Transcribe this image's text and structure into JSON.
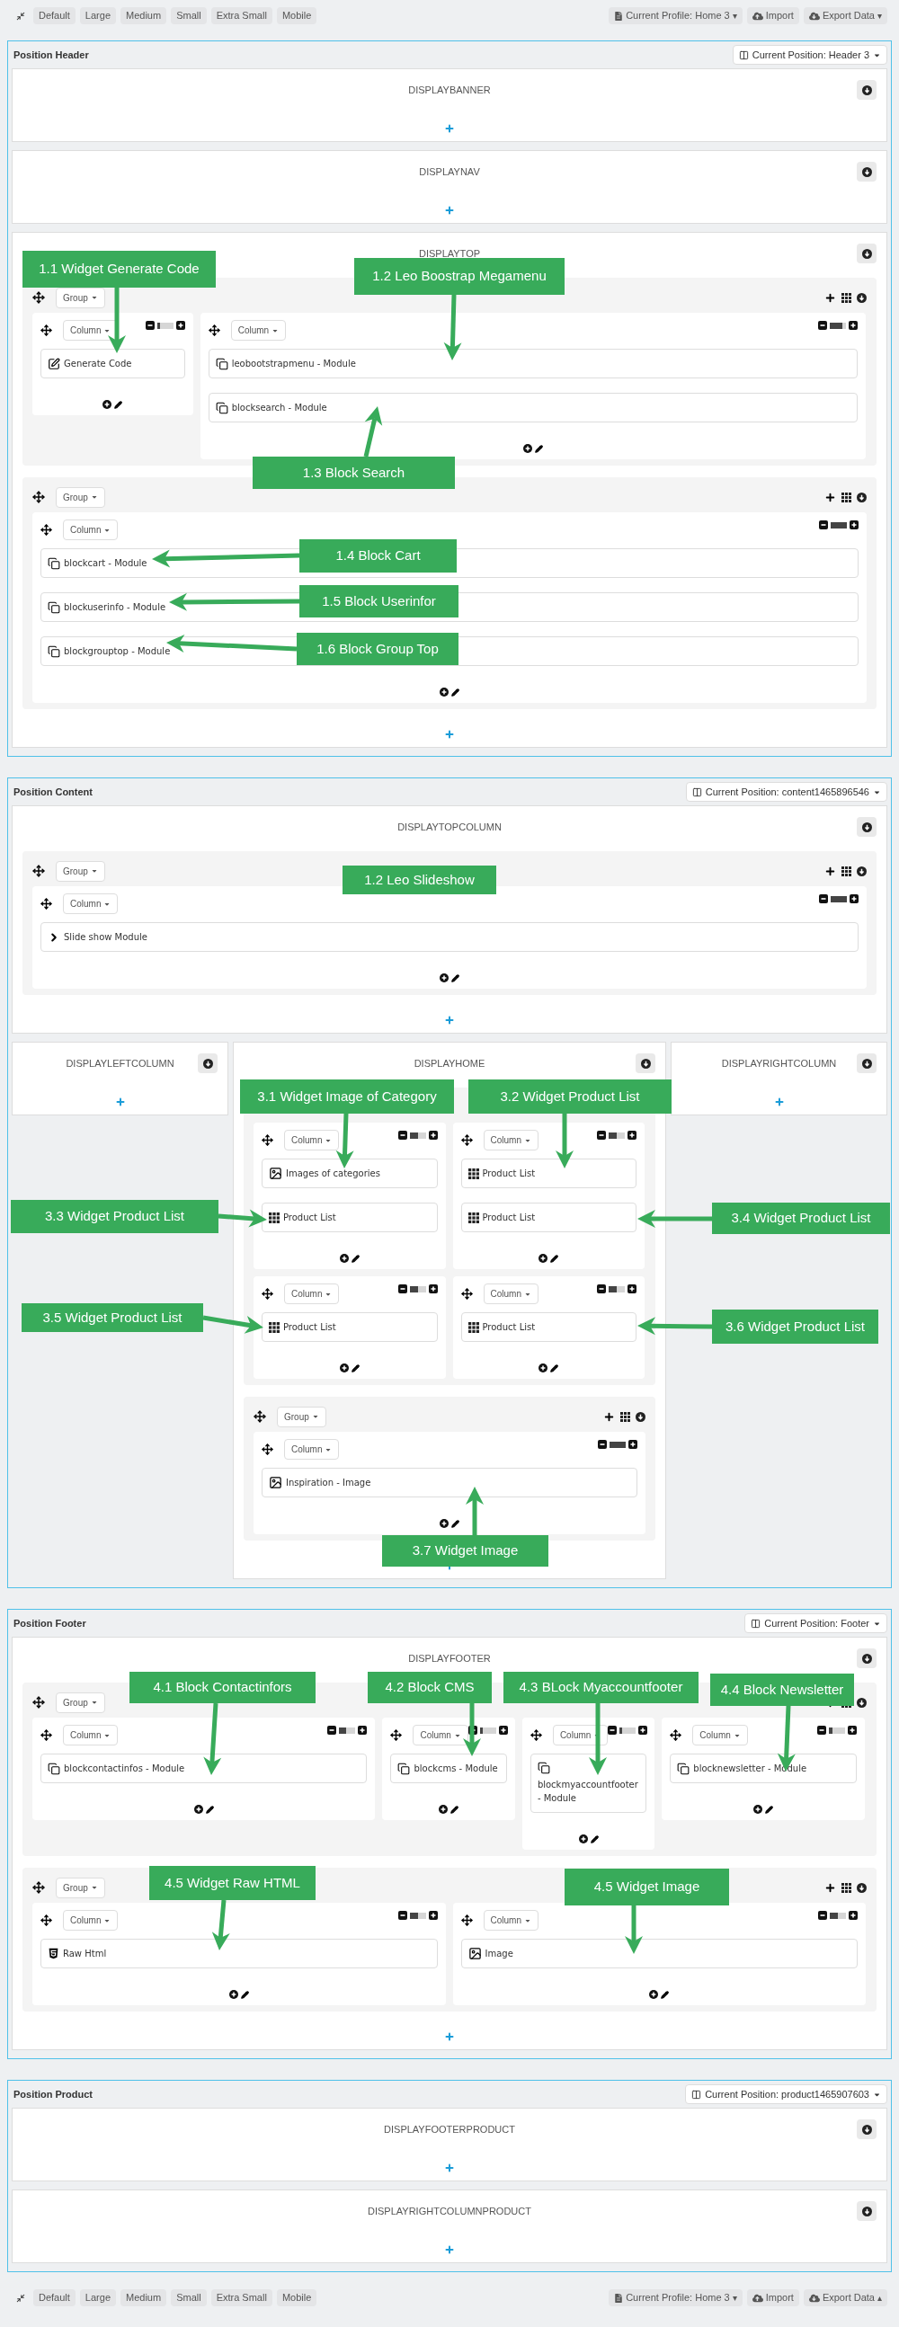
{
  "top_toolbar": {
    "devices": [
      {
        "label": "Default"
      },
      {
        "label": "Large"
      },
      {
        "label": "Medium"
      },
      {
        "label": "Small"
      },
      {
        "label": "Extra Small"
      },
      {
        "label": "Mobile"
      }
    ],
    "actions": [
      {
        "label": "Current Profile: Home 3",
        "caret": "▾"
      },
      {
        "label": "Import"
      },
      {
        "label": "Export Data",
        "caret": "▾"
      }
    ]
  },
  "positions": [
    {
      "title": "Position Header",
      "current_position": "Current Position: Header 3",
      "rows": [
        [
          {
            "name": "DISPLAYBANNER"
          }
        ],
        [
          {
            "name": "DISPLAYNAV"
          }
        ],
        [
          {
            "name": "DISPLAYTOP",
            "groups": [
              {
                "toolbar": true,
                "button": "Group",
                "columns": [
                  {
                    "button": "Column",
                    "level": 0.2,
                    "widgets": [
                      {
                        "kind": "edit",
                        "label": "Generate Code"
                      }
                    ]
                  },
                  {
                    "button": "Column",
                    "level": 0.8,
                    "widgets": [
                      {
                        "kind": "module",
                        "label": "leobootstrapmenu - Module"
                      },
                      {
                        "kind": "module",
                        "label": "blocksearch - Module"
                      }
                    ]
                  }
                ]
              },
              {
                "toolbar": true,
                "button": "Group",
                "columns": [
                  {
                    "button": "Column",
                    "level": 1,
                    "widgets": [
                      {
                        "kind": "module",
                        "label": "blockcart - Module"
                      },
                      {
                        "kind": "module",
                        "label": "blockuserinfo - Module"
                      },
                      {
                        "kind": "module",
                        "label": "blockgrouptop - Module"
                      }
                    ]
                  }
                ]
              }
            ]
          }
        ]
      ],
      "callouts": [
        {
          "label": "1.1 Widget Generate Code"
        },
        {
          "label": "1.2 Leo Boostrap Megamenu"
        },
        {
          "label": "1.3 Block Search"
        },
        {
          "label": "1.4 Block Cart"
        },
        {
          "label": "1.5 Block Userinfor"
        },
        {
          "label": "1.6 Block Group Top"
        }
      ]
    },
    {
      "title": "Position Content",
      "current_position": "Current Position: content1465896546",
      "rows": [
        [
          {
            "name": "DISPLAYTOPCOLUMN",
            "groups": [
              {
                "toolbar": true,
                "button": "Group",
                "columns": [
                  {
                    "button": "Column",
                    "level": 1,
                    "widgets": [
                      {
                        "kind": "chevron",
                        "label": "Slide show Module"
                      }
                    ]
                  }
                ]
              }
            ]
          }
        ],
        [
          {
            "name": "DISPLAYLEFTCOLUMN"
          },
          {
            "name": "DISPLAYHOME",
            "groups": [
              {
                "toolbar": false,
                "columns": [
                  {
                    "button": "Column",
                    "level": 0.5,
                    "widgets": [
                      {
                        "kind": "image",
                        "label": "Images of categories"
                      },
                      {
                        "kind": "grid",
                        "label": "Product List"
                      }
                    ]
                  },
                  {
                    "button": "Column",
                    "level": 0.5,
                    "widgets": [
                      {
                        "kind": "grid",
                        "label": "Product List"
                      },
                      {
                        "kind": "grid",
                        "label": "Product List"
                      }
                    ]
                  },
                  {
                    "button": "Column",
                    "level": 0.5,
                    "widgets": [
                      {
                        "kind": "grid",
                        "label": "Product List"
                      }
                    ]
                  },
                  {
                    "button": "Column",
                    "level": 0.5,
                    "widgets": [
                      {
                        "kind": "grid",
                        "label": "Product List"
                      }
                    ]
                  }
                ]
              },
              {
                "toolbar": true,
                "button": "Group",
                "columns": [
                  {
                    "button": "Column",
                    "level": 1,
                    "widgets": [
                      {
                        "kind": "image",
                        "label": "Inspiration - Image"
                      }
                    ]
                  }
                ]
              }
            ]
          },
          {
            "name": "DISPLAYRIGHTCOLUMN"
          }
        ]
      ],
      "callouts": [
        {
          "label": "1.2 Leo Slideshow"
        },
        {
          "label": "3.1 Widget Image of Category"
        },
        {
          "label": "3.2 Widget Product List"
        },
        {
          "label": "3.3 Widget Product List"
        },
        {
          "label": "3.4 Widget Product List"
        },
        {
          "label": "3.5 Widget Product List"
        },
        {
          "label": "3.6 Widget Product List"
        },
        {
          "label": "3.7 Widget Image"
        }
      ]
    },
    {
      "title": "Position Footer",
      "current_position": "Current Position: Footer",
      "rows": [
        [
          {
            "name": "DISPLAYFOOTER",
            "groups": [
              {
                "toolbar": true,
                "button": "Group",
                "columns": [
                  {
                    "button": "Column",
                    "level": 0.4166,
                    "widgets": [
                      {
                        "kind": "module",
                        "label": "blockcontactinfos - Module"
                      }
                    ]
                  },
                  {
                    "button": "Column",
                    "level": 0.1666,
                    "widgets": [
                      {
                        "kind": "module",
                        "label": "blockcms - Module"
                      }
                    ]
                  },
                  {
                    "button": "Column",
                    "level": 0.1666,
                    "widgets": [
                      {
                        "kind": "module",
                        "label": "blockmyaccountfooter - Module"
                      }
                    ]
                  },
                  {
                    "button": "Column",
                    "level": 0.25,
                    "widgets": [
                      {
                        "kind": "module",
                        "label": "blocknewsletter - Module"
                      }
                    ]
                  }
                ]
              },
              {
                "toolbar": true,
                "button": "Group",
                "columns": [
                  {
                    "button": "Column",
                    "level": 0.5,
                    "widgets": [
                      {
                        "kind": "html",
                        "label": "Raw Html"
                      }
                    ]
                  },
                  {
                    "button": "Column",
                    "level": 0.5,
                    "widgets": [
                      {
                        "kind": "image",
                        "label": "Image"
                      }
                    ]
                  }
                ]
              }
            ]
          }
        ]
      ],
      "callouts": [
        {
          "label": "4.1 Block Contactinfors"
        },
        {
          "label": "4.2 Block CMS"
        },
        {
          "label": "4.3 BLock Myaccountfooter"
        },
        {
          "label": "4.4 Block Newsletter"
        },
        {
          "label": "4.5 Widget Raw HTML"
        },
        {
          "label": "4.5 Widget Image"
        }
      ]
    },
    {
      "title": "Position Product",
      "current_position": "Current Position: product1465907603",
      "rows": [
        [
          {
            "name": "DISPLAYFOOTERPRODUCT"
          }
        ],
        [
          {
            "name": "DISPLAYRIGHTCOLUMNPRODUCT"
          }
        ]
      ]
    }
  ],
  "bottom_toolbar": {
    "devices": [
      {
        "label": "Default"
      },
      {
        "label": "Large"
      },
      {
        "label": "Medium"
      },
      {
        "label": "Small"
      },
      {
        "label": "Extra Small"
      },
      {
        "label": "Mobile"
      }
    ],
    "actions": [
      {
        "label": "Current Profile: Home 3",
        "caret": "▾"
      },
      {
        "label": "Import"
      },
      {
        "label": "Export Data",
        "caret": "▴"
      }
    ]
  }
}
